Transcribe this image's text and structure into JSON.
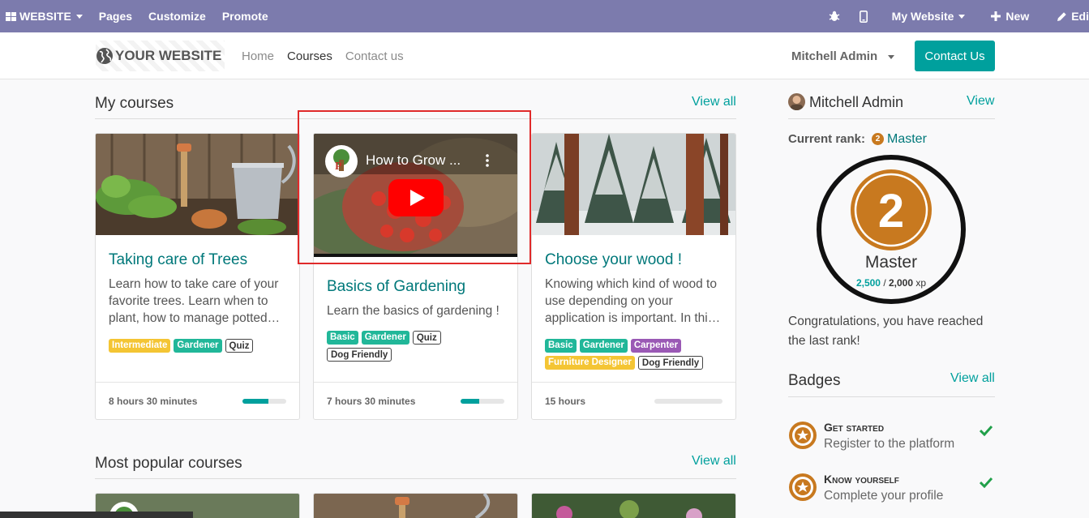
{
  "adminbar": {
    "apps_label": "WEBSITE",
    "menu": [
      "Pages",
      "Customize",
      "Promote"
    ],
    "my_website": "My Website",
    "new_label": "New",
    "edit_label": "Edi"
  },
  "header": {
    "logo_text": "YOUR WEBSITE",
    "nav": [
      "Home",
      "Courses",
      "Contact us"
    ],
    "user": "Mitchell Admin",
    "contact_btn": "Contact Us"
  },
  "my_courses": {
    "title": "My courses",
    "view_all": "View all",
    "cards": [
      {
        "title": "Taking care of Trees",
        "description": "Learn how to take care of your favorite trees. Learn when to plant, how to manage potted…",
        "tags": [
          {
            "label": "Intermediate",
            "color": "#f4c534",
            "style": "solid"
          },
          {
            "label": "Gardener",
            "color": "#21b799",
            "style": "solid"
          },
          {
            "label": "Quiz",
            "color": "#ffffff",
            "style": "outline"
          }
        ],
        "duration": "8 hours 30 minutes",
        "progress": 0.6
      },
      {
        "title": "Basics of Gardening",
        "video_title": "How to Grow ...",
        "description": "Learn the basics of gardening !",
        "tags": [
          {
            "label": "Basic",
            "color": "#21b799",
            "style": "solid"
          },
          {
            "label": "Gardener",
            "color": "#21b799",
            "style": "solid"
          },
          {
            "label": "Quiz",
            "color": "#ffffff",
            "style": "outline"
          },
          {
            "label": "Dog Friendly",
            "color": "#ffffff",
            "style": "outline"
          }
        ],
        "duration": "7 hours 30 minutes",
        "progress": 0.42
      },
      {
        "title": "Choose your wood !",
        "description": "Knowing which kind of wood to use depending on your application is important. In thi…",
        "tags": [
          {
            "label": "Basic",
            "color": "#21b799",
            "style": "solid"
          },
          {
            "label": "Gardener",
            "color": "#21b799",
            "style": "solid"
          },
          {
            "label": "Carpenter",
            "color": "#9a59b5",
            "style": "solid"
          },
          {
            "label": "Furniture Designer",
            "color": "#f4c534",
            "style": "solid"
          },
          {
            "label": "Dog Friendly",
            "color": "#ffffff",
            "style": "outline"
          }
        ],
        "duration": "15 hours",
        "progress": 0.0
      }
    ]
  },
  "popular": {
    "title": "Most popular courses",
    "view_all": "View all"
  },
  "sidebar": {
    "user_name": "Mitchell Admin",
    "view": "View",
    "rank_label": "Current rank:",
    "rank_name": "Master",
    "rank_number": "2",
    "ring_label": "Master",
    "xp_current": "2,500",
    "xp_sep": " / ",
    "xp_total": "2,000",
    "xp_unit": " xp",
    "congrats": "Congratulations, you have reached the last rank!",
    "badges_title": "Badges",
    "badges_view_all": "View all",
    "badges": [
      {
        "name": "Get started",
        "description": "Register to the platform"
      },
      {
        "name": "Know yourself",
        "description": "Complete your profile"
      }
    ]
  },
  "colors": {
    "admin_bar": "#7c7bad",
    "accent": "#00a09d",
    "rank_gold": "#c8791f"
  }
}
